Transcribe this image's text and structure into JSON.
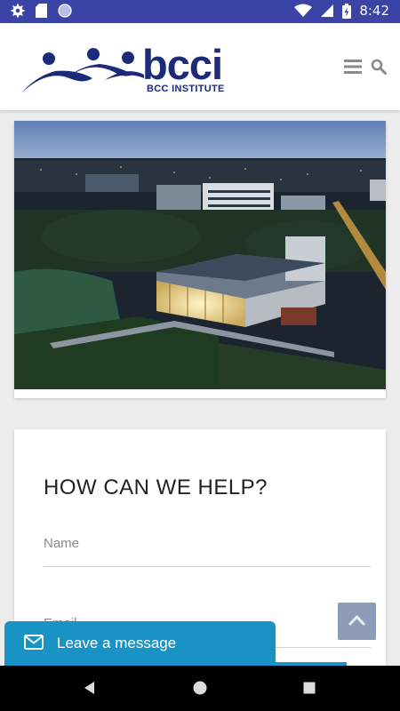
{
  "status_bar": {
    "time": "8:42",
    "left_icons": [
      "gear-icon",
      "sd-card-icon",
      "circle-icon"
    ],
    "right_icons": [
      "wifi-icon",
      "signal-icon",
      "battery-charging-icon"
    ],
    "bg_color": "#3a44a6"
  },
  "header": {
    "logo_text": "bcci",
    "logo_subtitle": "BCC INSTITUTE",
    "menu_icon": "hamburger-menu-icon",
    "search_icon": "search-icon",
    "brand_color": "#1d2a7a"
  },
  "hero": {
    "image": "aerial-night-campus-photo"
  },
  "contact_form": {
    "title": "HOW CAN WE HELP?",
    "name_label": "Name",
    "email_label": "Email"
  },
  "chat_widget": {
    "label": "Leave a message",
    "icon": "envelope-icon",
    "color": "#1993c6"
  },
  "scroll_top": {
    "icon": "chevron-up-icon",
    "color": "#8e9db5"
  },
  "nav_bar": {
    "back_icon": "back-triangle-icon",
    "home_icon": "home-circle-icon",
    "recents_icon": "recents-square-icon"
  }
}
